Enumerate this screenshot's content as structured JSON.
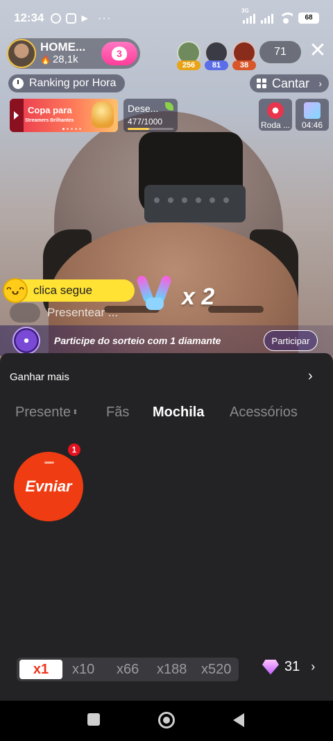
{
  "status_bar": {
    "time": "12:34",
    "network_label": "3G",
    "battery": "68",
    "more": "···"
  },
  "host": {
    "name": "HOME...",
    "likes": "28,1k",
    "follow_level": "3"
  },
  "viewers": [
    {
      "badge": "256",
      "badge_color": "#e8a416",
      "avatar_color": "#6f8a5c"
    },
    {
      "badge": "81",
      "badge_color": "#5b6ee8",
      "avatar_color": "#3b3b46"
    },
    {
      "badge": "38",
      "badge_color": "#d8572a",
      "avatar_color": "#8a2c1c"
    }
  ],
  "viewer_count": "71",
  "ranking_label": "Ranking por Hora",
  "cantar_label": "Cantar",
  "banner": {
    "title": "Copa para",
    "subtitle": "Streamers Brilhantes"
  },
  "desire": {
    "label": "Dese...",
    "progress_text": "477/1000",
    "progress": 0.477
  },
  "roda_label": "Roda ...",
  "timer_label": "04:46",
  "chat": {
    "message": "clica segue",
    "presentear": "Presentear ..."
  },
  "gift_multiplier": "x 2",
  "lottery": {
    "text": "Participe do sorteio com 1  diamante",
    "button": "Participar"
  },
  "panel": {
    "earn_more": "Ganhar mais",
    "tabs": [
      {
        "label": "Presente",
        "active": false
      },
      {
        "label": "Fãs",
        "active": false
      },
      {
        "label": "Mochila",
        "active": true
      },
      {
        "label": "Acessórios",
        "active": false
      }
    ],
    "item": {
      "label": "Evniar",
      "badge": "1"
    },
    "quantities": [
      "x1",
      "x10",
      "x66",
      "x188",
      "x520"
    ],
    "selected_quantity": "x1",
    "balance": "31"
  },
  "colors": {
    "accent": "#f0321c",
    "panel_bg": "#232325",
    "chat_bubble": "#ffe234"
  }
}
